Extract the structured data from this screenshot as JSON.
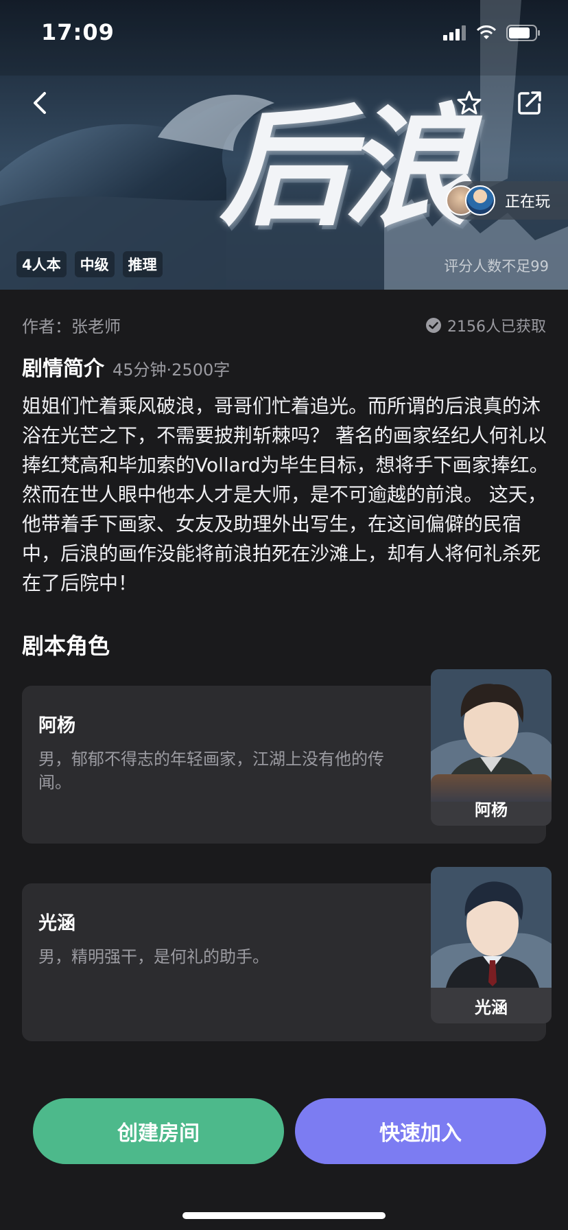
{
  "status": {
    "time": "17:09"
  },
  "hero": {
    "title_art": "后浪",
    "playing_label": "正在玩",
    "tags": [
      "4人本",
      "中级",
      "推理"
    ],
    "rating_note": "评分人数不足99"
  },
  "info": {
    "author": "作者：张老师",
    "obtained": "2156人已获取"
  },
  "synopsis": {
    "title": "剧情简介",
    "meta": "45分钟·2500字",
    "text": "姐姐们忙着乘风破浪，哥哥们忙着追光。而所谓的后浪真的沐浴在光芒之下，不需要披荆斩棘吗？ 著名的画家经纪人何礼以捧红梵高和毕加索的Vollard为毕生目标，想将手下画家捧红。然而在世人眼中他本人才是大师，是不可逾越的前浪。 这天，他带着手下画家、女友及助理外出写生，在这间偏僻的民宿中，后浪的画作没能将前浪拍死在沙滩上，却有人将何礼杀死在了后院中！"
  },
  "roles": {
    "title": "剧本角色",
    "items": [
      {
        "name": "阿杨",
        "desc": "男，郁郁不得志的年轻画家，江湖上没有他的传闻。"
      },
      {
        "name": "光涵",
        "desc": "男，精明强干，是何礼的助手。"
      }
    ]
  },
  "actions": {
    "create": "创建房间",
    "join": "快速加入"
  },
  "colors": {
    "create": "#4db98b",
    "join": "#7c7cf2",
    "background": "#1a1a1c"
  }
}
